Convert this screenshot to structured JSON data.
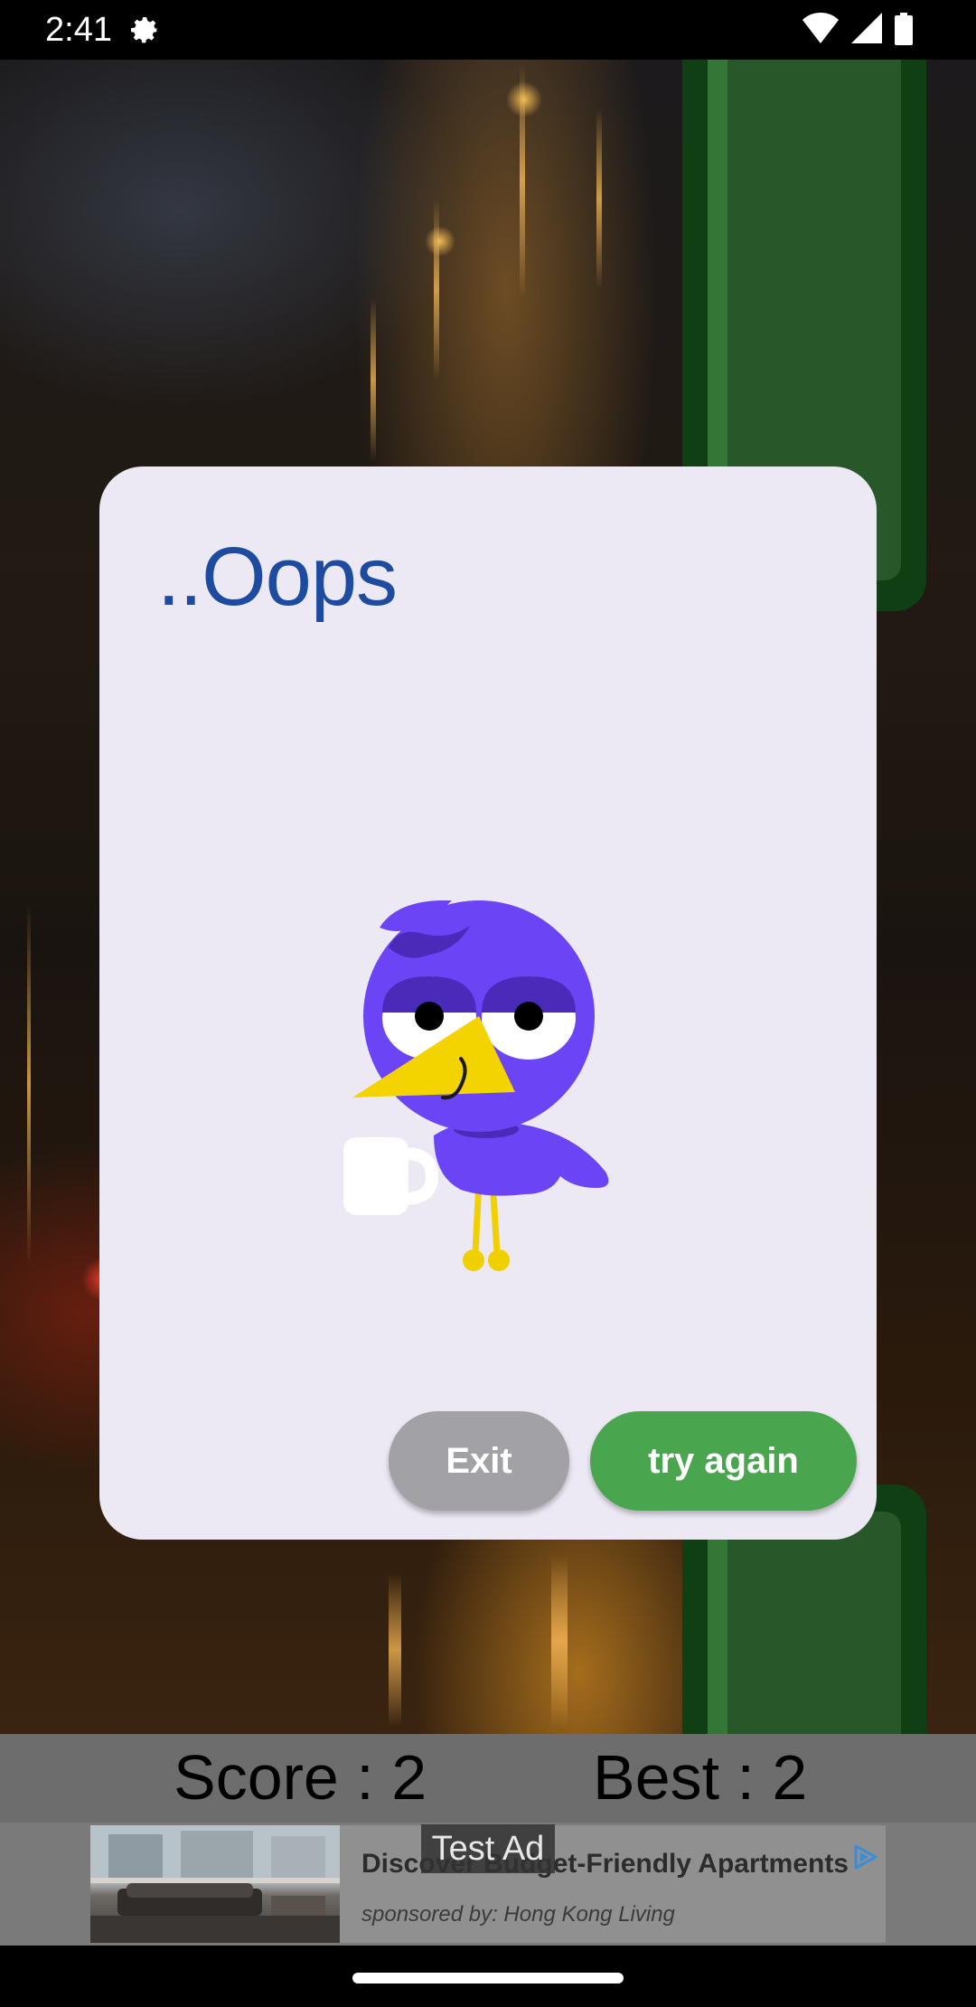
{
  "status_bar": {
    "time": "2:41",
    "icons": [
      "settings-gear-icon",
      "wifi-icon",
      "cell-signal-icon",
      "battery-icon"
    ]
  },
  "game": {
    "scene": "night-city-street",
    "pipe_color": "#285829",
    "pipe_border_color": "#0f3f12"
  },
  "dialog": {
    "title": "..Oops",
    "illustration": "purple-bird-holding-mug",
    "buttons": {
      "exit_label": "Exit",
      "try_again_label": "try again"
    },
    "colors": {
      "background": "#ece8f4",
      "title": "#1c4b9f",
      "exit_button": "#a2a1a6",
      "try_again_button": "#4aa54f"
    }
  },
  "score_bar": {
    "score_text": "Score : 2",
    "best_text": "Best : 2"
  },
  "ad": {
    "badge": "Test Ad",
    "headline": "Discover Budget-Friendly Apartments",
    "sponsor": "sponsored by: Hong Kong Living",
    "choices_icon": "ad-choices-icon"
  }
}
